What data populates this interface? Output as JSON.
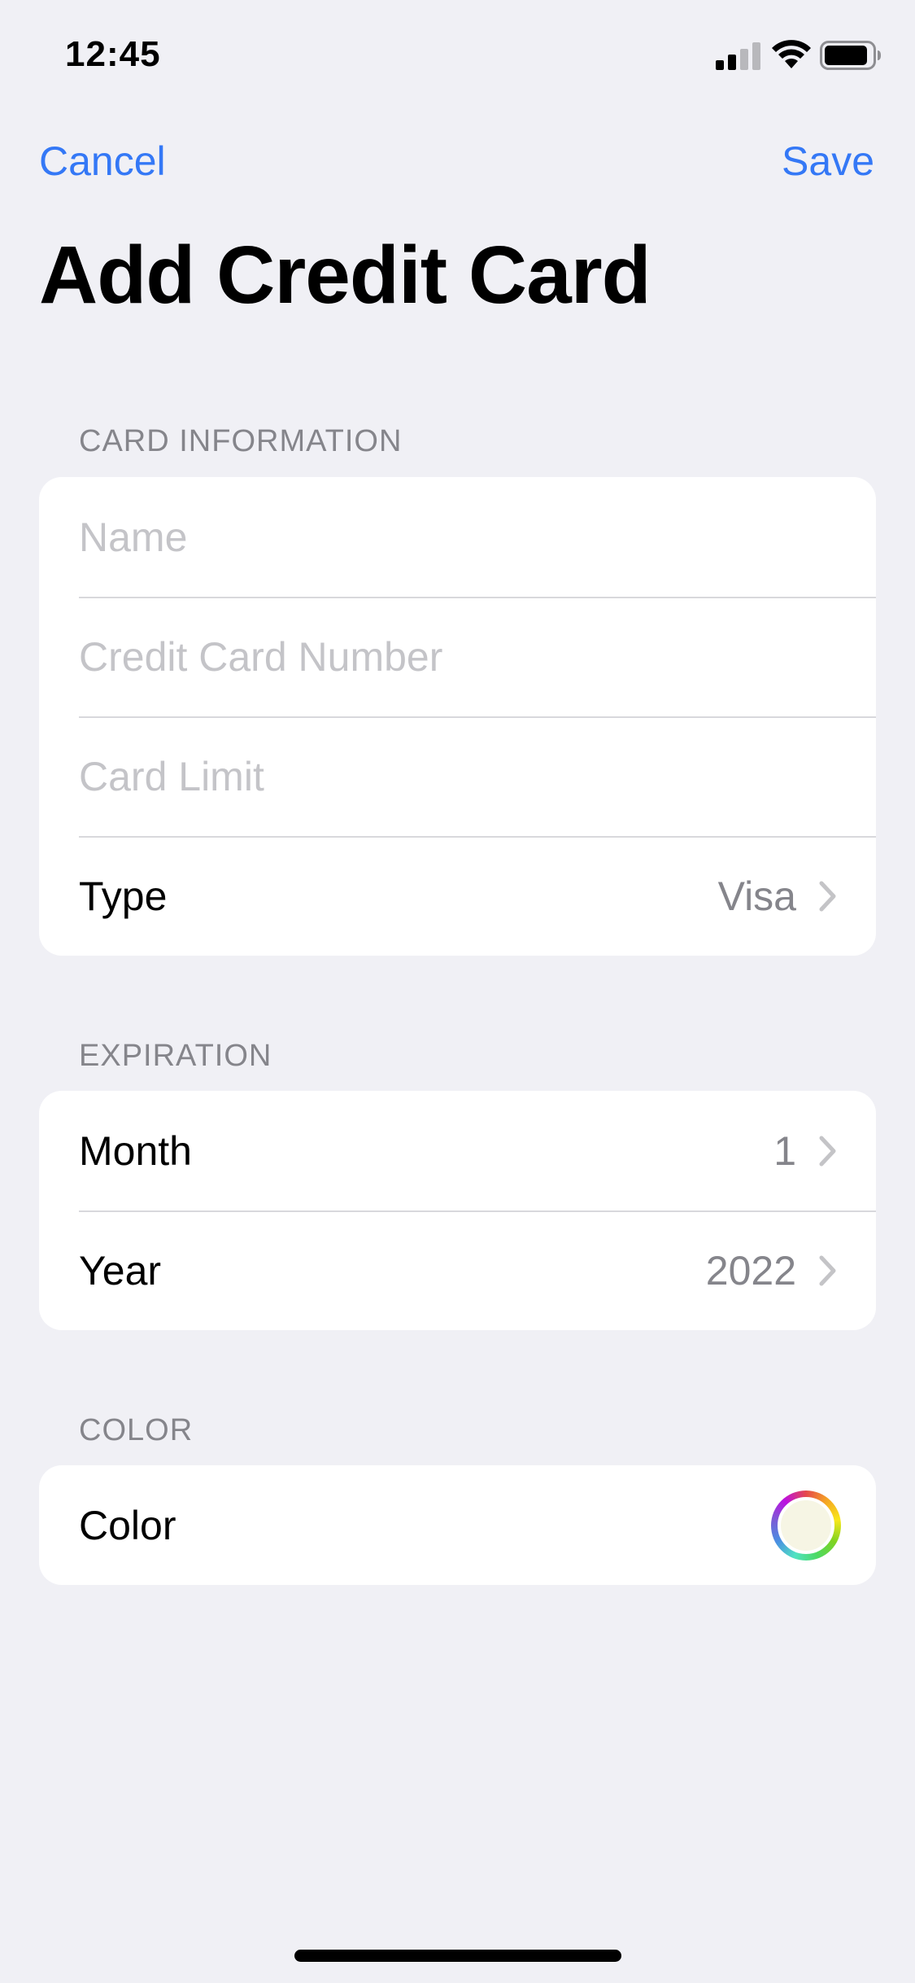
{
  "status_bar": {
    "time": "12:45",
    "icons": [
      "cellular-signal-icon",
      "wifi-icon",
      "battery-icon"
    ]
  },
  "nav": {
    "cancel_label": "Cancel",
    "save_label": "Save",
    "title": "Add Credit Card",
    "accent_color": "#3478f6"
  },
  "card_information": {
    "header": "CARD  INFORMATION",
    "name_placeholder": "Name",
    "number_placeholder": "Credit Card Number",
    "limit_placeholder": "Card Limit",
    "type_label": "Type",
    "type_value": "Visa"
  },
  "expiration": {
    "header": "EXPIRATION",
    "month_label": "Month",
    "month_value": "1",
    "year_label": "Year",
    "year_value": "2022"
  },
  "color": {
    "header": "COLOR",
    "label": "Color",
    "selected_color": "#f6f5e4"
  }
}
